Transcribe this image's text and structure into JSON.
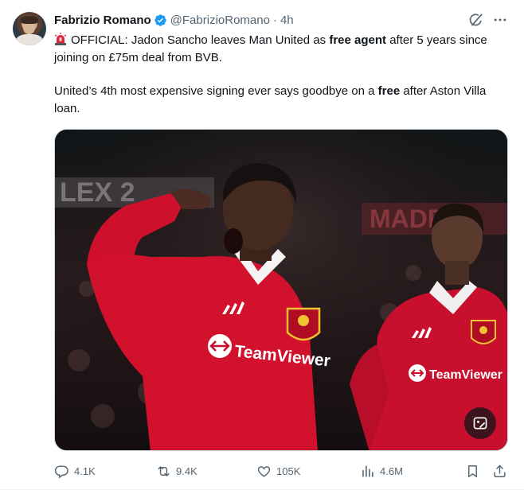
{
  "author": {
    "name": "Fabrizio Romano",
    "handle": "@FabrizioRomano",
    "separator": "·",
    "time": "4h",
    "verified": true
  },
  "tweet": {
    "line1_pre": "OFFICIAL: Jadon Sancho leaves Man United as ",
    "line1_bold": "free agent",
    "line1_post": " after 5 years since joining on £75m deal from BVB.",
    "line2_pre": "United’s 4th most expensive signing ever says goodbye on a ",
    "line2_bold": "free",
    "line2_post": " after Aston Villa loan.",
    "leading_icon": "siren-icon"
  },
  "media": {
    "jersey_sponsor_left": "TeamViewer",
    "jersey_sponsor_right": "TeamViewer",
    "stand_text_left": "LEX 2",
    "stand_text_right": "MADE",
    "colors": {
      "jersey": "#d0102a",
      "collar": "#f4f4f4",
      "background": "#1a1214"
    }
  },
  "actions": {
    "replies": "4.1K",
    "reposts": "9.4K",
    "likes": "105K",
    "views": "4.6M"
  },
  "colors": {
    "accent": "#1d9bf0",
    "muted": "#536471",
    "text": "#0f1419"
  }
}
